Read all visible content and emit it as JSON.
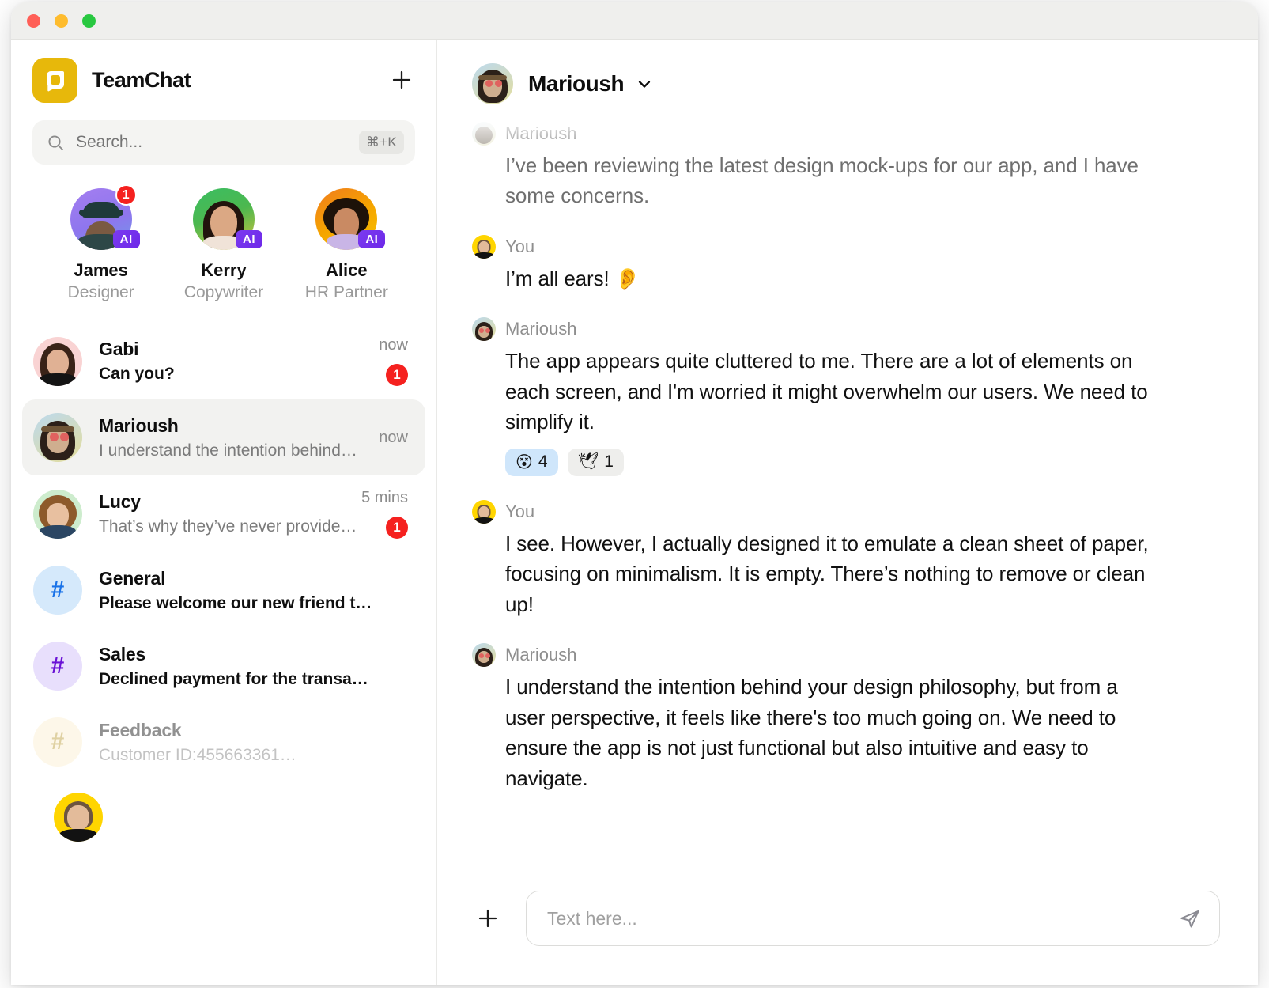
{
  "window": {
    "traffic_lights": [
      "close",
      "minimize",
      "zoom"
    ],
    "colors": {
      "close": "#ff5f57",
      "minimize": "#febc2e",
      "zoom": "#28c840"
    }
  },
  "sidebar": {
    "app_title": "TeamChat",
    "logo_color": "#e7b80b",
    "new_chat_label": "+",
    "search": {
      "placeholder": "Search...",
      "shortcut": "⌘+K"
    },
    "ai_contacts": [
      {
        "name": "James",
        "role": "Designer",
        "badge": "AI",
        "unread": "1",
        "ring": "#9b7df0"
      },
      {
        "name": "Kerry",
        "role": "Copywriter",
        "badge": "AI",
        "unread": "",
        "ring": "#21b24b"
      },
      {
        "name": "Alice",
        "role": "HR Partner",
        "badge": "AI",
        "unread": "",
        "ring": "#f7a500"
      }
    ],
    "conversations": [
      {
        "name": "Gabi",
        "preview": "Can you?",
        "time": "now",
        "unread": "1",
        "type": "dm",
        "bold_preview": true,
        "active": false,
        "dim": false,
        "avatar_bg": "#f9d3d3"
      },
      {
        "name": "Marioush",
        "preview": "I understand the intention behind…",
        "time": "now",
        "unread": "",
        "type": "dm",
        "bold_preview": false,
        "active": true,
        "dim": false,
        "avatar_bg": "#d6e7f4"
      },
      {
        "name": "Lucy",
        "preview": "That’s why they’ve never provide…",
        "time": "5 mins",
        "unread": "1",
        "type": "dm",
        "bold_preview": false,
        "active": false,
        "dim": false,
        "avatar_bg": "#cdeccd"
      },
      {
        "name": "General",
        "preview": "Please welcome our new friend t…",
        "time": "",
        "unread": "",
        "type": "channel",
        "bold_preview": true,
        "active": false,
        "dim": false,
        "avatar_bg": "#d5e9fb",
        "hash_color": "#1a73e8"
      },
      {
        "name": "Sales",
        "preview": "Declined payment for the transa…",
        "time": "",
        "unread": "",
        "type": "channel",
        "bold_preview": true,
        "active": false,
        "dim": false,
        "avatar_bg": "#e8dffc",
        "hash_color": "#6a12d6"
      },
      {
        "name": "Feedback",
        "preview": "Customer ID:455663361…",
        "time": "",
        "unread": "",
        "type": "channel",
        "bold_preview": false,
        "active": false,
        "dim": true,
        "avatar_bg": "#fbefcf",
        "hash_color": "#b99a34"
      }
    ],
    "me_avatar_bg": "#ffd500"
  },
  "chat": {
    "header": {
      "title": "Marioush",
      "chevron": "chevron-down"
    },
    "messages": [
      {
        "author": "Marioush",
        "text": "I’ve been reviewing the latest design mock-ups for our app, and I have some concerns.",
        "self": false,
        "faded": true,
        "reactions": []
      },
      {
        "author": "You",
        "text": "I’m all ears! 👂",
        "self": true,
        "faded": false,
        "reactions": []
      },
      {
        "author": "Marioush",
        "text": "The app appears quite cluttered to me. There are a lot of elements on each screen, and I'm worried it might overwhelm our users. We need to simplify it.",
        "self": false,
        "faded": false,
        "reactions": [
          {
            "emoji": "😵",
            "count": "4",
            "active": true
          },
          {
            "emoji": "🕊",
            "count": "1",
            "active": false
          }
        ]
      },
      {
        "author": "You",
        "text": "I see. However, I actually designed it to emulate a clean sheet of paper, focusing on minimalism. It is empty. There’s nothing to remove or clean up!",
        "self": true,
        "faded": false,
        "reactions": []
      },
      {
        "author": "Marioush",
        "text": "I understand the intention behind your design philosophy, but from a user perspective, it feels like there's too much going on. We need to ensure the app is not just functional but also intuitive and easy to navigate.",
        "self": false,
        "faded": false,
        "reactions": []
      }
    ],
    "composer": {
      "add_label": "+",
      "placeholder": "Text here...",
      "value": "",
      "send_label": "send"
    }
  }
}
